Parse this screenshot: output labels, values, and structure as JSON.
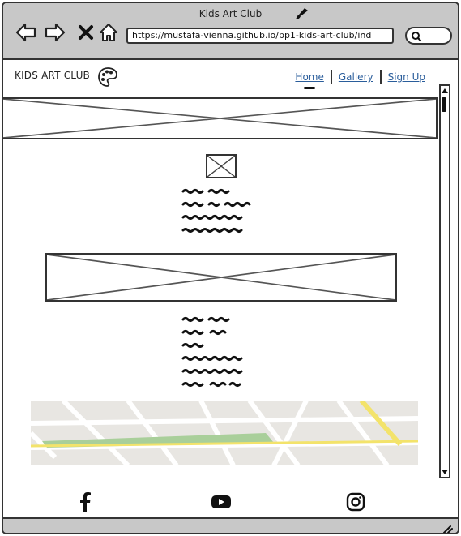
{
  "window": {
    "title": "Kids Art Club"
  },
  "browser": {
    "url": "https://mustafa-vienna.github.io/pp1-kids-art-club/ind",
    "icons": [
      "back-arrow-icon",
      "forward-arrow-icon",
      "close-icon",
      "home-icon",
      "search-icon",
      "paintbrush-icon"
    ]
  },
  "site": {
    "logo": "KIDS ART CLUB",
    "logo_icon": "palette-icon",
    "nav": {
      "home": "Home",
      "gallery": "Gallery",
      "signup": "Sign Up",
      "active": "Home"
    }
  },
  "footer": {
    "social_icons": [
      "facebook-icon",
      "youtube-icon",
      "instagram-icon"
    ]
  },
  "colors": {
    "chrome": "#c8c8c8",
    "link": "#2a5d9b",
    "map_green": "#a9cf9a",
    "map_yellow": "#f3e36b"
  }
}
